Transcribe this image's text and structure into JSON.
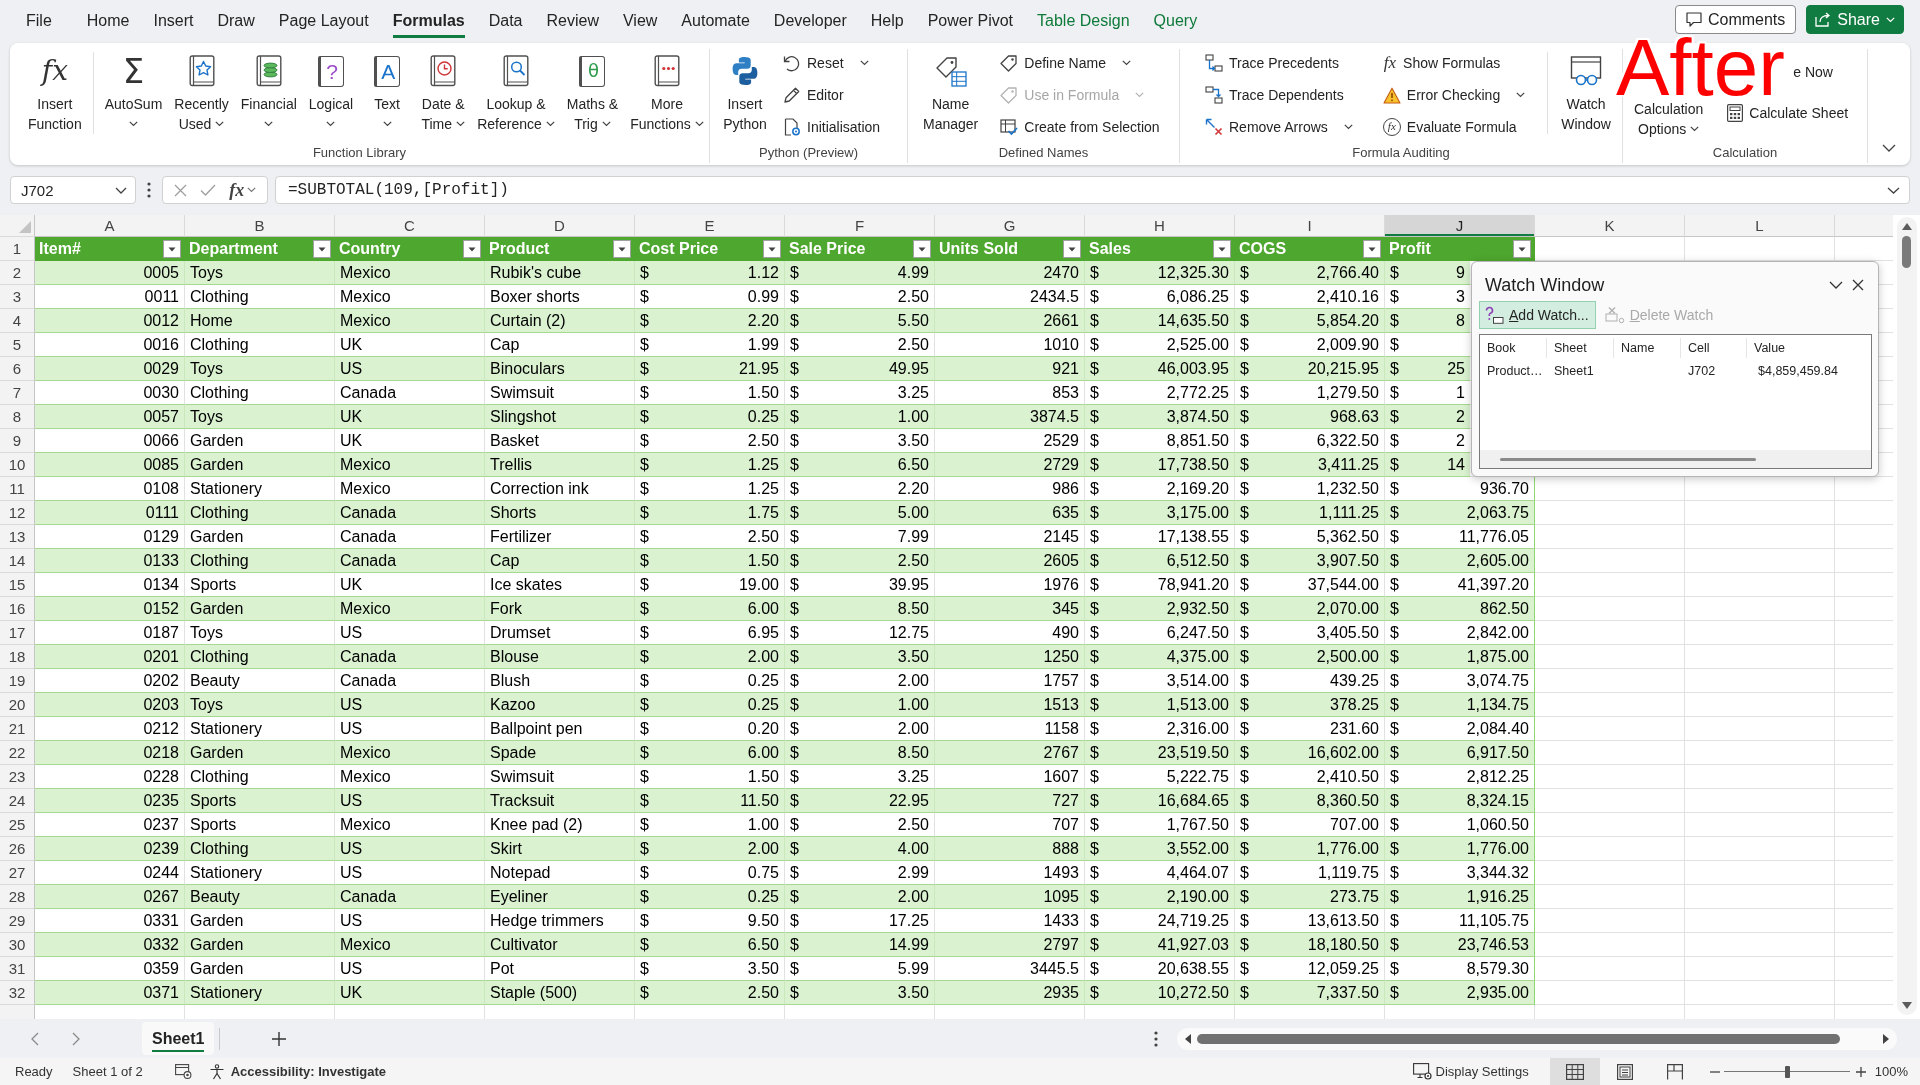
{
  "ribbon_tabs": [
    {
      "label": "File",
      "selected": false,
      "contextual": false
    },
    {
      "label": "Home",
      "selected": false,
      "contextual": false
    },
    {
      "label": "Insert",
      "selected": false,
      "contextual": false
    },
    {
      "label": "Draw",
      "selected": false,
      "contextual": false
    },
    {
      "label": "Page Layout",
      "selected": false,
      "contextual": false
    },
    {
      "label": "Formulas",
      "selected": true,
      "contextual": false
    },
    {
      "label": "Data",
      "selected": false,
      "contextual": false
    },
    {
      "label": "Review",
      "selected": false,
      "contextual": false
    },
    {
      "label": "View",
      "selected": false,
      "contextual": false
    },
    {
      "label": "Automate",
      "selected": false,
      "contextual": false
    },
    {
      "label": "Developer",
      "selected": false,
      "contextual": false
    },
    {
      "label": "Help",
      "selected": false,
      "contextual": false
    },
    {
      "label": "Power Pivot",
      "selected": false,
      "contextual": false
    },
    {
      "label": "Table Design",
      "selected": false,
      "contextual": true
    },
    {
      "label": "Query",
      "selected": false,
      "contextual": true
    }
  ],
  "header_buttons": {
    "comments": "Comments",
    "share": "Share"
  },
  "annotation": {
    "text": "After"
  },
  "ribbon": {
    "groups": [
      {
        "label": "Function Library",
        "items": [
          {
            "kind": "large",
            "lines": [
              "Insert",
              "Function"
            ],
            "glyph": "fx",
            "dropdown": false
          },
          {
            "kind": "separator"
          },
          {
            "kind": "large",
            "lines": [
              "AutoSum"
            ],
            "glyph": "Σ",
            "dropdown": true
          },
          {
            "kind": "large",
            "lines": [
              "Recently",
              "Used"
            ],
            "dropdown": true
          },
          {
            "kind": "large",
            "lines": [
              "Financial"
            ],
            "dropdown": true
          },
          {
            "kind": "large",
            "lines": [
              "Logical"
            ],
            "glyph": "?",
            "dropdown": true
          },
          {
            "kind": "large",
            "lines": [
              "Text"
            ],
            "glyph": "A",
            "dropdown": true
          },
          {
            "kind": "large",
            "lines": [
              "Date &",
              "Time"
            ],
            "dropdown": true
          },
          {
            "kind": "large",
            "lines": [
              "Lookup &",
              "Reference"
            ],
            "dropdown": true
          },
          {
            "kind": "large",
            "lines": [
              "Maths &",
              "Trig"
            ],
            "glyph": "θ",
            "dropdown": true
          },
          {
            "kind": "large",
            "lines": [
              "More",
              "Functions"
            ],
            "dropdown": true
          }
        ]
      },
      {
        "label": "Python (Preview)",
        "items": [
          {
            "kind": "large",
            "lines": [
              "Insert",
              "Python"
            ],
            "dropdown": false
          },
          {
            "kind": "stack",
            "items": [
              {
                "label": "Reset",
                "dropdown": true,
                "disabled": false
              },
              {
                "label": "Editor",
                "dropdown": false,
                "disabled": false
              },
              {
                "label": "Initialisation",
                "dropdown": false,
                "disabled": false
              }
            ]
          }
        ]
      },
      {
        "label": "Defined Names",
        "items": [
          {
            "kind": "large",
            "lines": [
              "Name",
              "Manager"
            ],
            "dropdown": false
          },
          {
            "kind": "stack",
            "items": [
              {
                "label": "Define Name",
                "dropdown": true,
                "disabled": false
              },
              {
                "label": "Use in Formula",
                "dropdown": true,
                "disabled": true
              },
              {
                "label": "Create from Selection",
                "dropdown": false,
                "disabled": false
              }
            ]
          }
        ]
      },
      {
        "label": "Formula Auditing",
        "items": [
          {
            "kind": "stack",
            "items": [
              {
                "label": "Trace Precedents",
                "dropdown": false,
                "disabled": false
              },
              {
                "label": "Trace Dependents",
                "dropdown": false,
                "disabled": false
              },
              {
                "label": "Remove Arrows",
                "dropdown": true,
                "disabled": false
              }
            ]
          },
          {
            "kind": "stack",
            "items": [
              {
                "label": "Show Formulas",
                "glyph": "fx",
                "dropdown": false,
                "disabled": false
              },
              {
                "label": "Error Checking",
                "dropdown": true,
                "disabled": false
              },
              {
                "label": "Evaluate Formula",
                "glyph": "fx",
                "dropdown": false,
                "disabled": false
              }
            ]
          },
          {
            "kind": "separator"
          },
          {
            "kind": "large",
            "lines": [
              "Watch",
              "Window"
            ],
            "dropdown": false
          }
        ]
      },
      {
        "label": "Calculation",
        "items": [
          {
            "kind": "large",
            "lines": [
              "Calculation",
              "Options"
            ],
            "dropdown": true
          },
          {
            "kind": "stack",
            "items": [
              {
                "label": "e Now",
                "dropdown": false,
                "disabled": false
              },
              {
                "label": "Calculate Sheet",
                "dropdown": false,
                "disabled": false
              }
            ]
          }
        ]
      }
    ]
  },
  "formula_bar": {
    "name_box": "J702",
    "function_glyph": "fx",
    "formula": "=SUBTOTAL(109,[Profit])"
  },
  "sheet": {
    "column_letters": [
      {
        "label": "A",
        "selected": false
      },
      {
        "label": "B",
        "selected": false
      },
      {
        "label": "C",
        "selected": false
      },
      {
        "label": "D",
        "selected": false
      },
      {
        "label": "E",
        "selected": false
      },
      {
        "label": "F",
        "selected": false
      },
      {
        "label": "G",
        "selected": false
      },
      {
        "label": "H",
        "selected": false
      },
      {
        "label": "I",
        "selected": false
      },
      {
        "label": "J",
        "selected": true
      },
      {
        "label": "K",
        "selected": false
      },
      {
        "label": "L",
        "selected": false
      }
    ],
    "header_row_number": "1",
    "columns": [
      {
        "label": "Item#",
        "kind": "number"
      },
      {
        "label": "Department",
        "kind": "text"
      },
      {
        "label": "Country",
        "kind": "text"
      },
      {
        "label": "Product",
        "kind": "text"
      },
      {
        "label": "Cost Price",
        "kind": "currency"
      },
      {
        "label": "Sale Price",
        "kind": "currency"
      },
      {
        "label": "Units Sold",
        "kind": "number"
      },
      {
        "label": "Sales",
        "kind": "currency"
      },
      {
        "label": "COGS",
        "kind": "currency"
      },
      {
        "label": "Profit",
        "kind": "currency"
      }
    ],
    "rows": [
      {
        "number": "2",
        "cells": [
          "0005",
          "Toys",
          "Mexico",
          "Rubik's cube",
          "$ 1.12",
          "$ 4.99",
          "2470",
          "$ 12,325.30",
          "$ 2,766.40",
          "$ 9"
        ]
      },
      {
        "number": "3",
        "cells": [
          "0011",
          "Clothing",
          "Mexico",
          "Boxer shorts",
          "$ 0.99",
          "$ 2.50",
          "2434.5",
          "$ 6,086.25",
          "$ 2,410.16",
          "$ 3"
        ]
      },
      {
        "number": "4",
        "cells": [
          "0012",
          "Home",
          "Mexico",
          "Curtain (2)",
          "$ 2.20",
          "$ 5.50",
          "2661",
          "$ 14,635.50",
          "$ 5,854.20",
          "$ 8"
        ]
      },
      {
        "number": "5",
        "cells": [
          "0016",
          "Clothing",
          "UK",
          "Cap",
          "$ 1.99",
          "$ 2.50",
          "1010",
          "$ 2,525.00",
          "$ 2,009.90",
          "$"
        ]
      },
      {
        "number": "6",
        "cells": [
          "0029",
          "Toys",
          "US",
          "Binoculars",
          "$ 21.95",
          "$ 49.95",
          "921",
          "$ 46,003.95",
          "$ 20,215.95",
          "$ 25"
        ]
      },
      {
        "number": "7",
        "cells": [
          "0030",
          "Clothing",
          "Canada",
          "Swimsuit",
          "$ 1.50",
          "$ 3.25",
          "853",
          "$ 2,772.25",
          "$ 1,279.50",
          "$ 1"
        ]
      },
      {
        "number": "8",
        "cells": [
          "0057",
          "Toys",
          "UK",
          "Slingshot",
          "$ 0.25",
          "$ 1.00",
          "3874.5",
          "$ 3,874.50",
          "$ 968.63",
          "$ 2"
        ]
      },
      {
        "number": "9",
        "cells": [
          "0066",
          "Garden",
          "UK",
          "Basket",
          "$ 2.50",
          "$ 3.50",
          "2529",
          "$ 8,851.50",
          "$ 6,322.50",
          "$ 2"
        ]
      },
      {
        "number": "10",
        "cells": [
          "0085",
          "Garden",
          "Mexico",
          "Trellis",
          "$ 1.25",
          "$ 6.50",
          "2729",
          "$ 17,738.50",
          "$ 3,411.25",
          "$ 14"
        ]
      },
      {
        "number": "11",
        "cells": [
          "0108",
          "Stationery",
          "Mexico",
          "Correction ink",
          "$ 1.25",
          "$ 2.20",
          "986",
          "$ 2,169.20",
          "$ 1,232.50",
          "$ 936.70"
        ]
      },
      {
        "number": "12",
        "cells": [
          "0111",
          "Clothing",
          "Canada",
          "Shorts",
          "$ 1.75",
          "$ 5.00",
          "635",
          "$ 3,175.00",
          "$ 1,111.25",
          "$ 2,063.75"
        ]
      },
      {
        "number": "13",
        "cells": [
          "0129",
          "Garden",
          "Canada",
          "Fertilizer",
          "$ 2.50",
          "$ 7.99",
          "2145",
          "$ 17,138.55",
          "$ 5,362.50",
          "$ 11,776.05"
        ]
      },
      {
        "number": "14",
        "cells": [
          "0133",
          "Clothing",
          "Canada",
          "Cap",
          "$ 1.50",
          "$ 2.50",
          "2605",
          "$ 6,512.50",
          "$ 3,907.50",
          "$ 2,605.00"
        ]
      },
      {
        "number": "15",
        "cells": [
          "0134",
          "Sports",
          "UK",
          "Ice skates",
          "$ 19.00",
          "$ 39.95",
          "1976",
          "$ 78,941.20",
          "$ 37,544.00",
          "$ 41,397.20"
        ]
      },
      {
        "number": "16",
        "cells": [
          "0152",
          "Garden",
          "Mexico",
          "Fork",
          "$ 6.00",
          "$ 8.50",
          "345",
          "$ 2,932.50",
          "$ 2,070.00",
          "$ 862.50"
        ]
      },
      {
        "number": "17",
        "cells": [
          "0187",
          "Toys",
          "US",
          "Drumset",
          "$ 6.95",
          "$ 12.75",
          "490",
          "$ 6,247.50",
          "$ 3,405.50",
          "$ 2,842.00"
        ]
      },
      {
        "number": "18",
        "cells": [
          "0201",
          "Clothing",
          "Canada",
          "Blouse",
          "$ 2.00",
          "$ 3.50",
          "1250",
          "$ 4,375.00",
          "$ 2,500.00",
          "$ 1,875.00"
        ]
      },
      {
        "number": "19",
        "cells": [
          "0202",
          "Beauty",
          "Canada",
          "Blush",
          "$ 0.25",
          "$ 2.00",
          "1757",
          "$ 3,514.00",
          "$ 439.25",
          "$ 3,074.75"
        ]
      },
      {
        "number": "20",
        "cells": [
          "0203",
          "Toys",
          "US",
          "Kazoo",
          "$ 0.25",
          "$ 1.00",
          "1513",
          "$ 1,513.00",
          "$ 378.25",
          "$ 1,134.75"
        ]
      },
      {
        "number": "21",
        "cells": [
          "0212",
          "Stationery",
          "US",
          "Ballpoint pen",
          "$ 0.20",
          "$ 2.00",
          "1158",
          "$ 2,316.00",
          "$ 231.60",
          "$ 2,084.40"
        ]
      },
      {
        "number": "22",
        "cells": [
          "0218",
          "Garden",
          "Mexico",
          "Spade",
          "$ 6.00",
          "$ 8.50",
          "2767",
          "$ 23,519.50",
          "$ 16,602.00",
          "$ 6,917.50"
        ]
      },
      {
        "number": "23",
        "cells": [
          "0228",
          "Clothing",
          "Mexico",
          "Swimsuit",
          "$ 1.50",
          "$ 3.25",
          "1607",
          "$ 5,222.75",
          "$ 2,410.50",
          "$ 2,812.25"
        ]
      },
      {
        "number": "24",
        "cells": [
          "0235",
          "Sports",
          "US",
          "Tracksuit",
          "$ 11.50",
          "$ 22.95",
          "727",
          "$ 16,684.65",
          "$ 8,360.50",
          "$ 8,324.15"
        ]
      },
      {
        "number": "25",
        "cells": [
          "0237",
          "Sports",
          "Mexico",
          "Knee pad (2)",
          "$ 1.00",
          "$ 2.50",
          "707",
          "$ 1,767.50",
          "$ 707.00",
          "$ 1,060.50"
        ]
      },
      {
        "number": "26",
        "cells": [
          "0239",
          "Clothing",
          "US",
          "Skirt",
          "$ 2.00",
          "$ 4.00",
          "888",
          "$ 3,552.00",
          "$ 1,776.00",
          "$ 1,776.00"
        ]
      },
      {
        "number": "27",
        "cells": [
          "0244",
          "Stationery",
          "US",
          "Notepad",
          "$ 0.75",
          "$ 2.99",
          "1493",
          "$ 4,464.07",
          "$ 1,119.75",
          "$ 3,344.32"
        ]
      },
      {
        "number": "28",
        "cells": [
          "0267",
          "Beauty",
          "Canada",
          "Eyeliner",
          "$ 0.25",
          "$ 2.00",
          "1095",
          "$ 2,190.00",
          "$ 273.75",
          "$ 1,916.25"
        ]
      },
      {
        "number": "29",
        "cells": [
          "0331",
          "Garden",
          "US",
          "Hedge trimmers",
          "$ 9.50",
          "$ 17.25",
          "1433",
          "$ 24,719.25",
          "$ 13,613.50",
          "$ 11,105.75"
        ]
      },
      {
        "number": "30",
        "cells": [
          "0332",
          "Garden",
          "Mexico",
          "Cultivator",
          "$ 6.50",
          "$ 14.99",
          "2797",
          "$ 41,927.03",
          "$ 18,180.50",
          "$ 23,746.53"
        ]
      },
      {
        "number": "31",
        "cells": [
          "0359",
          "Garden",
          "US",
          "Pot",
          "$ 3.50",
          "$ 5.99",
          "3445.5",
          "$ 20,638.55",
          "$ 12,059.25",
          "$ 8,579.30"
        ]
      },
      {
        "number": "32",
        "cells": [
          "0371",
          "Stationery",
          "UK",
          "Staple (500)",
          "$ 2.50",
          "$ 3.50",
          "2935",
          "$ 10,272.50",
          "$ 7,337.50",
          "$ 2,935.00"
        ]
      }
    ]
  },
  "watch_window": {
    "title": "Watch Window",
    "buttons": [
      {
        "label": "Add Watch...",
        "highlighted": true,
        "disabled": false
      },
      {
        "label": "Delete Watch",
        "highlighted": false,
        "disabled": true
      }
    ],
    "columns": [
      "Book",
      "Sheet",
      "Name",
      "Cell",
      "Value"
    ],
    "rows": [
      {
        "book": "Product…",
        "sheet": "Sheet1",
        "cell": "J702",
        "value": "$4,859,459.84"
      }
    ]
  },
  "sheet_tabs": [
    {
      "label": "Sheet1",
      "selected": true
    }
  ],
  "status_bar": {
    "ready": "Ready",
    "sheet_position": "Sheet 1 of 2",
    "accessibility": "Accessibility: Investigate",
    "display_settings": "Display Settings",
    "views": [
      {
        "kind": "normal",
        "selected": true
      },
      {
        "kind": "page_layout",
        "selected": false
      },
      {
        "kind": "page_break",
        "selected": false
      }
    ],
    "zoom": {
      "level": 0.5,
      "reading": "100%"
    }
  }
}
